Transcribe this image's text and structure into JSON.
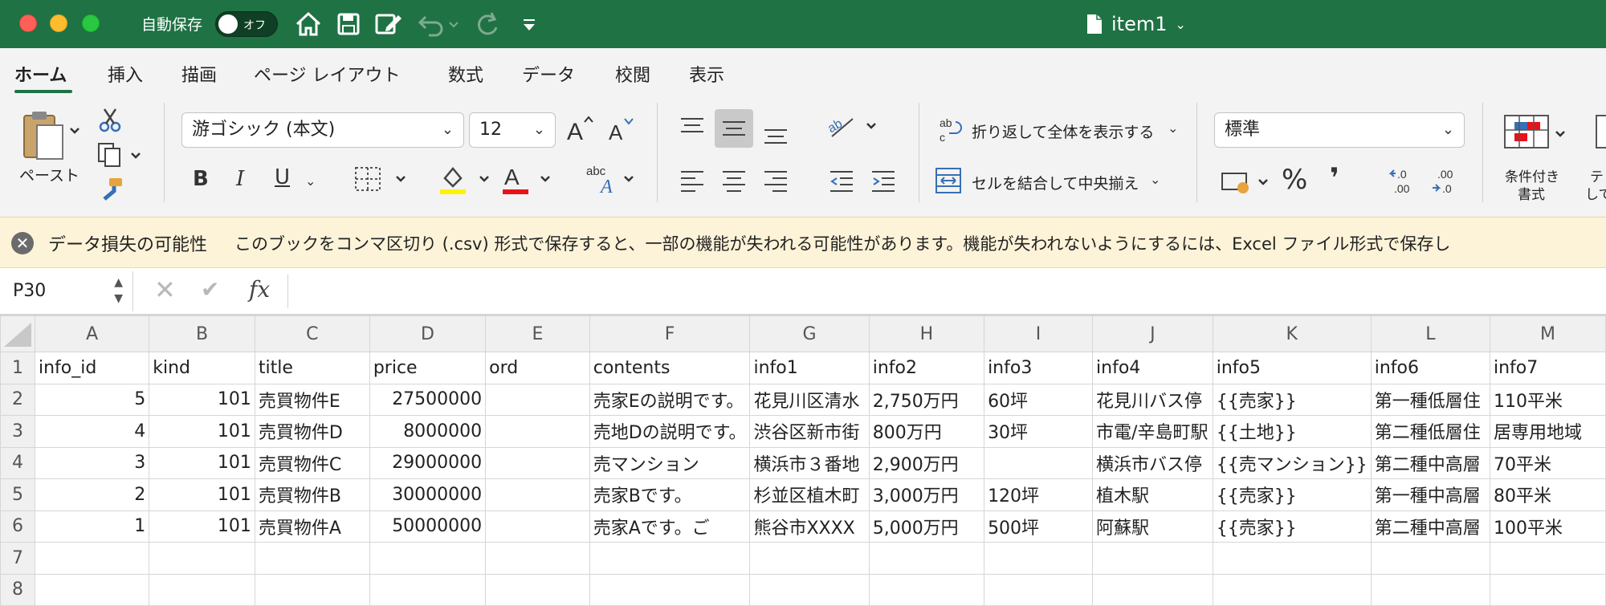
{
  "titlebar": {
    "autosave_label": "自動保存",
    "toggle_text": "オフ",
    "doc_title": "item1"
  },
  "tabs": [
    "ホーム",
    "挿入",
    "描画",
    "ページ レイアウト",
    "数式",
    "データ",
    "校閲",
    "表示"
  ],
  "ribbon": {
    "paste_label": "ペースト",
    "font_name": "游ゴシック (本文)",
    "font_size": "12",
    "bold": "B",
    "italic": "I",
    "underline": "U",
    "wrap_text": "折り返して全体を表示する",
    "merge_center": "セルを結合して中央揃え",
    "number_format": "標準",
    "percent": "%",
    "comma": "❜",
    "cond_format_line1": "条件付き",
    "cond_format_line2": "書式",
    "table_format_line1": "テ",
    "table_format_line2": "して"
  },
  "warning": {
    "title": "データ損失の可能性",
    "message": "このブックをコンマ区切り (.csv) 形式で保存すると、一部の機能が失われる可能性があります。機能が失われないようにするには、Excel ファイル形式で保存し"
  },
  "formula_bar": {
    "name_box": "P30",
    "fx": "fx",
    "content": ""
  },
  "sheet": {
    "columns": [
      "A",
      "B",
      "C",
      "D",
      "E",
      "F",
      "G",
      "H",
      "I",
      "J",
      "K",
      "L",
      "M"
    ],
    "rows": [
      {
        "num": "1",
        "cells": [
          "info_id",
          "kind",
          "title",
          "price",
          "ord",
          "contents",
          "info1",
          "info2",
          "info3",
          "info4",
          "info5",
          "info6",
          "info7"
        ]
      },
      {
        "num": "2",
        "cells": [
          "5",
          "101",
          "売買物件E",
          "27500000",
          "",
          "売家Eの説明です。",
          "花見川区清水",
          "2,750万円",
          "60坪",
          "花見川バス停",
          "{{売家}}",
          "第一種低層住",
          "110平米"
        ]
      },
      {
        "num": "3",
        "cells": [
          "4",
          "101",
          "売買物件D",
          "8000000",
          "",
          "売地Dの説明です。",
          "渋谷区新市街",
          "800万円",
          "30坪",
          "市電/辛島町駅",
          "{{土地}}",
          "第二種低層住",
          "居専用地域"
        ]
      },
      {
        "num": "4",
        "cells": [
          "3",
          "101",
          "売買物件C",
          "29000000",
          "",
          "売マンション",
          "横浜市３番地",
          "2,900万円",
          "",
          "横浜市バス停",
          "{{売マンション}}",
          "第二種中高層",
          "70平米"
        ]
      },
      {
        "num": "5",
        "cells": [
          "2",
          "101",
          "売買物件B",
          "30000000",
          "",
          "売家Bです。",
          "杉並区植木町",
          "3,000万円",
          "120坪",
          "植木駅",
          "{{売家}}",
          "第一種中高層",
          "80平米"
        ]
      },
      {
        "num": "6",
        "cells": [
          "1",
          "101",
          "売買物件A",
          "50000000",
          "",
          "売家Aです。ご",
          "熊谷市XXXX",
          "5,000万円",
          "500坪",
          "阿蘇駅",
          "{{売家}}",
          "第二種中高層",
          "100平米"
        ]
      },
      {
        "num": "7",
        "cells": [
          "",
          "",
          "",
          "",
          "",
          "",
          "",
          "",
          "",
          "",
          "",
          "",
          ""
        ]
      },
      {
        "num": "8",
        "cells": [
          "",
          "",
          "",
          "",
          "",
          "",
          "",
          "",
          "",
          "",
          "",
          "",
          ""
        ]
      }
    ]
  },
  "colors": {
    "title_green": "#1f7244",
    "ribbon_bg": "#f3f3f3",
    "warning_bg": "#fdf3d8",
    "font_color_red": "#e8131a",
    "highlight_yellow": "#fff200"
  }
}
